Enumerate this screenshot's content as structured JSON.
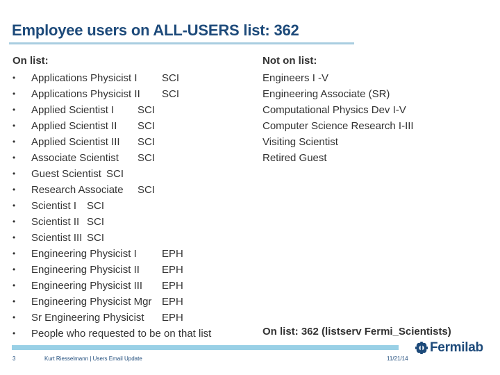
{
  "title": "Employee users on ALL-USERS list: 362",
  "on_list": {
    "heading": "On list:",
    "bullet": "•",
    "items": [
      {
        "name": "Applications Physicist I",
        "code": "SCI"
      },
      {
        "name": "Applications Physicist II",
        "code": "SCI"
      },
      {
        "name": "Applied Scientist I",
        "code": "SCI"
      },
      {
        "name": "Applied Scientist II",
        "code": "SCI"
      },
      {
        "name": "Applied Scientist III",
        "code": "SCI"
      },
      {
        "name": "Associate Scientist",
        "code": "SCI"
      },
      {
        "name": "Guest Scientist",
        "code": "SCI"
      },
      {
        "name": "Research Associate",
        "code": "SCI"
      },
      {
        "name": "Scientist I",
        "code": "SCI"
      },
      {
        "name": "Scientist II",
        "code": "SCI"
      },
      {
        "name": "Scientist III",
        "code": "SCI"
      },
      {
        "name": "Engineering Physicist I",
        "code": "EPH"
      },
      {
        "name": "Engineering Physicist II",
        "code": "EPH"
      },
      {
        "name": "Engineering Physicist III",
        "code": "EPH"
      },
      {
        "name": "Engineering Physicist Mgr",
        "code": "EPH"
      },
      {
        "name": "Sr Engineering Physicist",
        "code": "EPH"
      },
      {
        "name": "People who requested to be on that list",
        "code": ""
      }
    ]
  },
  "not_on_list": {
    "heading": "Not on list:",
    "items": [
      "Engineers I -V",
      "Engineering Associate (SR)",
      "Computational Physics Dev I-V",
      "Computer Science Research I-III",
      "Visiting Scientist",
      "Retired Guest"
    ]
  },
  "summary": "On list: 362 (listserv Fermi_Scientists)",
  "footer": {
    "page_number": "3",
    "text": "Kurt Riesselmann | Users Email Update",
    "date": "11/21/14",
    "logo_text": "Fermilab"
  },
  "colors": {
    "title": "#1d4a7a",
    "title_rule": "#a9cde0",
    "footer_rule": "#99d0e6",
    "logo": "#1d4a7a"
  }
}
